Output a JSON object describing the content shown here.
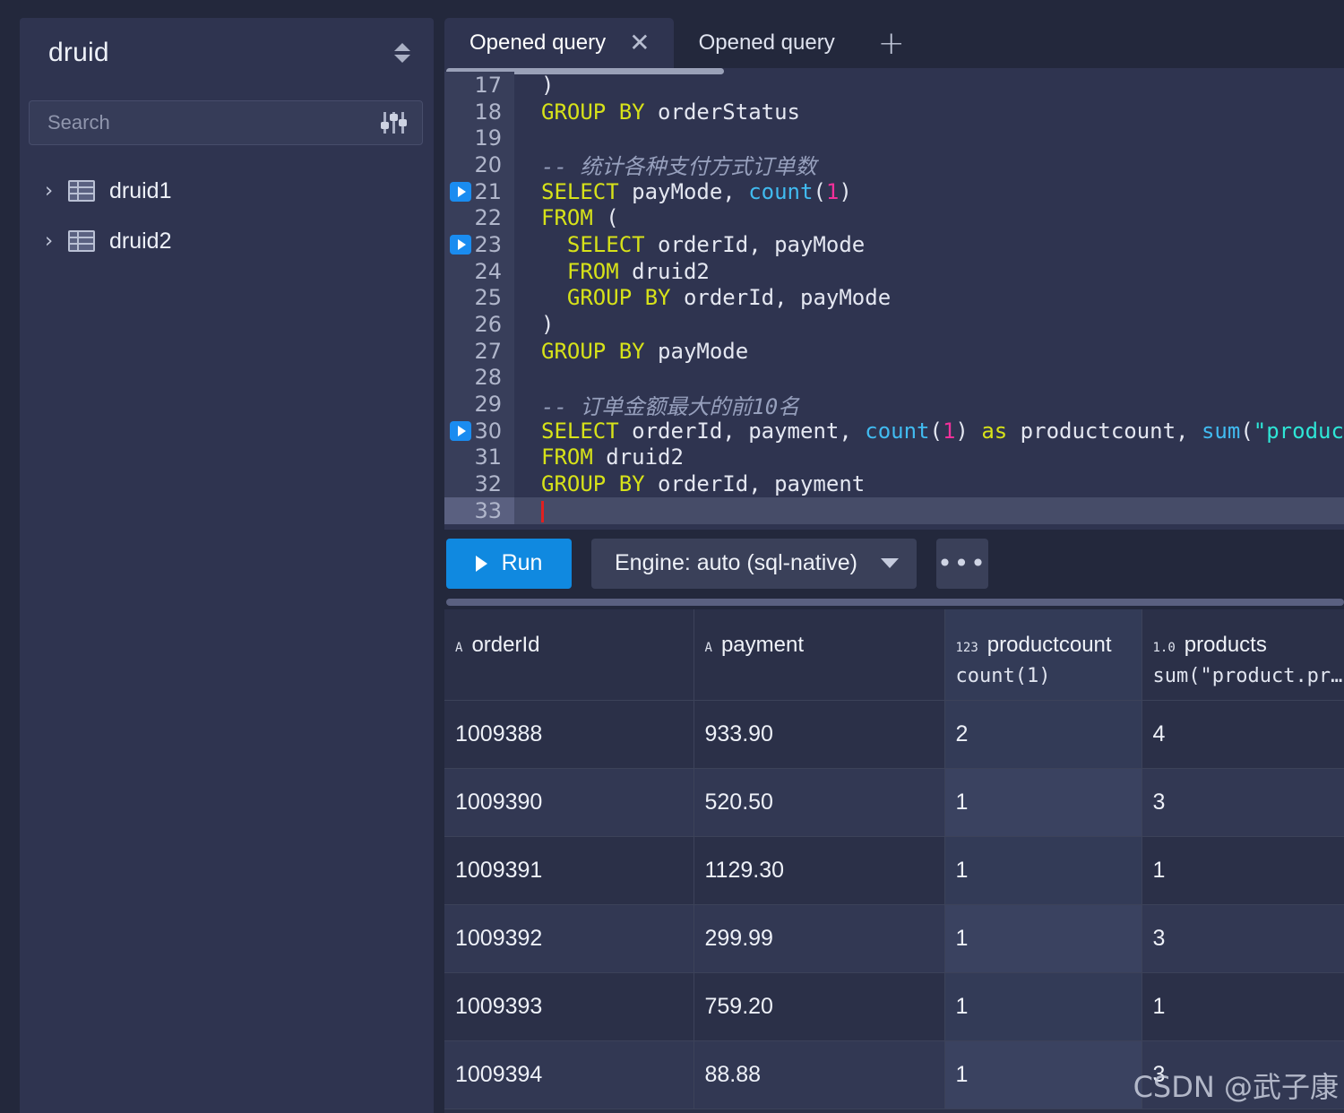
{
  "sidebar": {
    "title": "druid",
    "sort_icon": "sort-updown-icon",
    "search": {
      "value": "",
      "placeholder": "Search",
      "filter_icon": "filter-sliders-icon"
    },
    "tree": [
      {
        "label": "druid1",
        "chevron": "›",
        "icon": "table-icon"
      },
      {
        "label": "druid2",
        "chevron": "›",
        "icon": "table-icon"
      }
    ]
  },
  "tabs": {
    "items": [
      {
        "label": "Opened query",
        "active": true,
        "close": "✕"
      },
      {
        "label": "Opened query",
        "active": false
      }
    ],
    "new_tab": "+"
  },
  "editor": {
    "lines": [
      {
        "n": "17",
        "run": false,
        "tokens": [
          {
            "t": ")",
            "c": "pl"
          }
        ]
      },
      {
        "n": "18",
        "run": false,
        "tokens": [
          {
            "t": "GROUP BY",
            "c": "kw"
          },
          {
            "t": " orderStatus",
            "c": "pl"
          }
        ]
      },
      {
        "n": "19",
        "run": false,
        "tokens": [
          {
            "t": "",
            "c": "pl"
          }
        ]
      },
      {
        "n": "20",
        "run": false,
        "tokens": [
          {
            "t": "-- 统计各种支付方式订单数",
            "c": "cmt"
          }
        ]
      },
      {
        "n": "21",
        "run": true,
        "tokens": [
          {
            "t": "SELECT",
            "c": "kw"
          },
          {
            "t": " payMode, ",
            "c": "pl"
          },
          {
            "t": "count",
            "c": "fn"
          },
          {
            "t": "(",
            "c": "pl"
          },
          {
            "t": "1",
            "c": "num"
          },
          {
            "t": ")",
            "c": "pl"
          }
        ]
      },
      {
        "n": "22",
        "run": false,
        "tokens": [
          {
            "t": "FROM",
            "c": "kw"
          },
          {
            "t": " (",
            "c": "pl"
          }
        ]
      },
      {
        "n": "23",
        "run": true,
        "tokens": [
          {
            "t": "  SELECT",
            "c": "kw"
          },
          {
            "t": " orderId, payMode",
            "c": "pl"
          }
        ]
      },
      {
        "n": "24",
        "run": false,
        "tokens": [
          {
            "t": "  FROM",
            "c": "kw"
          },
          {
            "t": " druid2",
            "c": "pl"
          }
        ]
      },
      {
        "n": "25",
        "run": false,
        "tokens": [
          {
            "t": "  GROUP BY",
            "c": "kw"
          },
          {
            "t": " orderId, payMode",
            "c": "pl"
          }
        ]
      },
      {
        "n": "26",
        "run": false,
        "tokens": [
          {
            "t": ")",
            "c": "pl"
          }
        ]
      },
      {
        "n": "27",
        "run": false,
        "tokens": [
          {
            "t": "GROUP BY",
            "c": "kw"
          },
          {
            "t": " payMode",
            "c": "pl"
          }
        ]
      },
      {
        "n": "28",
        "run": false,
        "tokens": [
          {
            "t": "",
            "c": "pl"
          }
        ]
      },
      {
        "n": "29",
        "run": false,
        "tokens": [
          {
            "t": "-- 订单金额最大的前10名",
            "c": "cmt"
          }
        ]
      },
      {
        "n": "30",
        "run": true,
        "tokens": [
          {
            "t": "SELECT",
            "c": "kw"
          },
          {
            "t": " orderId, payment, ",
            "c": "pl"
          },
          {
            "t": "count",
            "c": "fn"
          },
          {
            "t": "(",
            "c": "pl"
          },
          {
            "t": "1",
            "c": "num"
          },
          {
            "t": ") ",
            "c": "pl"
          },
          {
            "t": "as",
            "c": "kw"
          },
          {
            "t": " productcount, ",
            "c": "pl"
          },
          {
            "t": "sum",
            "c": "fn"
          },
          {
            "t": "(",
            "c": "pl"
          },
          {
            "t": "\"product.pro",
            "c": "str"
          }
        ]
      },
      {
        "n": "31",
        "run": false,
        "tokens": [
          {
            "t": "FROM",
            "c": "kw"
          },
          {
            "t": " druid2",
            "c": "pl"
          }
        ]
      },
      {
        "n": "32",
        "run": false,
        "tokens": [
          {
            "t": "GROUP BY",
            "c": "kw"
          },
          {
            "t": " orderId, payment",
            "c": "pl"
          }
        ]
      },
      {
        "n": "33",
        "run": false,
        "active": true,
        "tokens": []
      }
    ]
  },
  "toolbar": {
    "run_label": "Run",
    "engine_label": "Engine: auto (sql-native)",
    "more_label": "•••"
  },
  "results": {
    "columns": [
      {
        "type_badge": "A",
        "name": "orderId",
        "sub": "",
        "selected": false
      },
      {
        "type_badge": "A",
        "name": "payment",
        "sub": "",
        "selected": false
      },
      {
        "type_badge": "123",
        "name": "productcount",
        "sub": "count(1)",
        "selected": true
      },
      {
        "type_badge": "1.0",
        "name": "products",
        "sub": "sum(\"product.pr…",
        "selected": false
      }
    ],
    "rows": [
      [
        "1009388",
        "933.90",
        "2",
        "4"
      ],
      [
        "1009390",
        "520.50",
        "1",
        "3"
      ],
      [
        "1009391",
        "1129.30",
        "1",
        "1"
      ],
      [
        "1009392",
        "299.99",
        "1",
        "3"
      ],
      [
        "1009393",
        "759.20",
        "1",
        "1"
      ],
      [
        "1009394",
        "88.88",
        "1",
        "3"
      ]
    ]
  },
  "watermark": "CSDN @武子康",
  "colors": {
    "accent": "#1089e0",
    "keyword": "#d7e219",
    "function": "#41bbf0",
    "number": "#f2309a",
    "string": "#2ee6d6",
    "comment": "#97a0bd",
    "panel": "#2f3450",
    "app_bg": "#23283c"
  }
}
